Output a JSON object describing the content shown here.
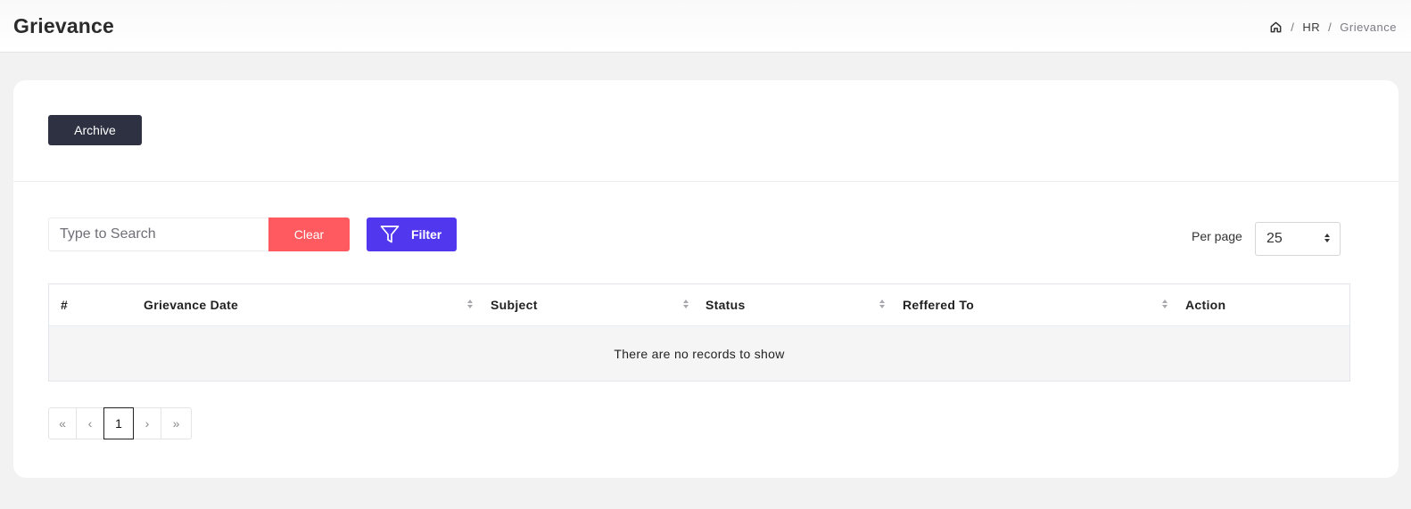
{
  "header": {
    "title": "Grievance",
    "breadcrumb": {
      "home_icon": "home-icon",
      "separator": "/",
      "items": [
        "HR",
        "Grievance"
      ]
    }
  },
  "toolbar": {
    "archive_label": "Archive",
    "search_placeholder": "Type to Search",
    "search_value": "",
    "clear_label": "Clear",
    "filter_label": "Filter",
    "filter_icon": "funnel-icon",
    "per_page_label": "Per page",
    "per_page_value": "25"
  },
  "table": {
    "columns": [
      {
        "label": "#",
        "sortable": false
      },
      {
        "label": "Grievance Date",
        "sortable": true
      },
      {
        "label": "Subject",
        "sortable": true
      },
      {
        "label": "Status",
        "sortable": true
      },
      {
        "label": "Reffered To",
        "sortable": true
      },
      {
        "label": "Action",
        "sortable": false
      }
    ],
    "empty_message": "There are no records to show"
  },
  "pagination": {
    "first": "«",
    "prev": "‹",
    "pages": [
      "1"
    ],
    "current": "1",
    "next": "›",
    "last": "»"
  },
  "colors": {
    "archive_button": "#2d3142",
    "clear_button": "#ff5a5f",
    "filter_button": "#5138ee",
    "page_background": "#f2f2f3"
  }
}
